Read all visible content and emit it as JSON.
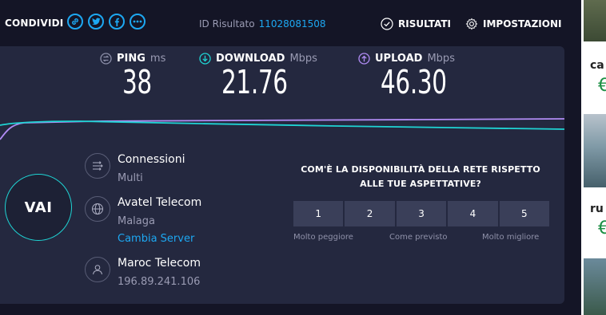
{
  "header": {
    "share_label": "CONDIVIDI",
    "share_icons": [
      "link-icon",
      "twitter-icon",
      "facebook-icon",
      "more-icon"
    ],
    "result_id_label": "ID Risultato",
    "result_id_value": "11028081508",
    "results_label": "RISULTATI",
    "settings_label": "IMPOSTAZIONI"
  },
  "metrics": {
    "ping": {
      "label": "PING",
      "unit": "ms",
      "value": "38",
      "color": "#8b8ea8"
    },
    "download": {
      "label": "DOWNLOAD",
      "unit": "Mbps",
      "value": "21.76",
      "color": "#1fd4d4"
    },
    "upload": {
      "label": "UPLOAD",
      "unit": "Mbps",
      "value": "46.30",
      "color": "#b18cf5"
    }
  },
  "go_button": {
    "label": "VAI"
  },
  "connections": {
    "title": "Connessioni",
    "mode": "Multi"
  },
  "server": {
    "provider": "Avatel Telecom",
    "city": "Malaga",
    "change_label": "Cambia Server"
  },
  "client": {
    "provider": "Maroc Telecom",
    "ip": "196.89.241.106"
  },
  "survey": {
    "question": "COM'È LA DISPONIBILITÀ DELLA RETE RISPETTO ALLE TUE ASPETTATIVE?",
    "options": [
      "1",
      "2",
      "3",
      "4",
      "5"
    ],
    "low_label": "Molto peggiore",
    "mid_label": "Come previsto",
    "high_label": "Molto migliore"
  },
  "ad": {
    "snippet1": "ca",
    "price1": "€",
    "snippet2": "ru",
    "price2": "€"
  },
  "colors": {
    "accent": "#1da8f2",
    "download": "#1fd4d4",
    "upload": "#b18cf5",
    "panel": "#24283f",
    "background": "#141526"
  }
}
